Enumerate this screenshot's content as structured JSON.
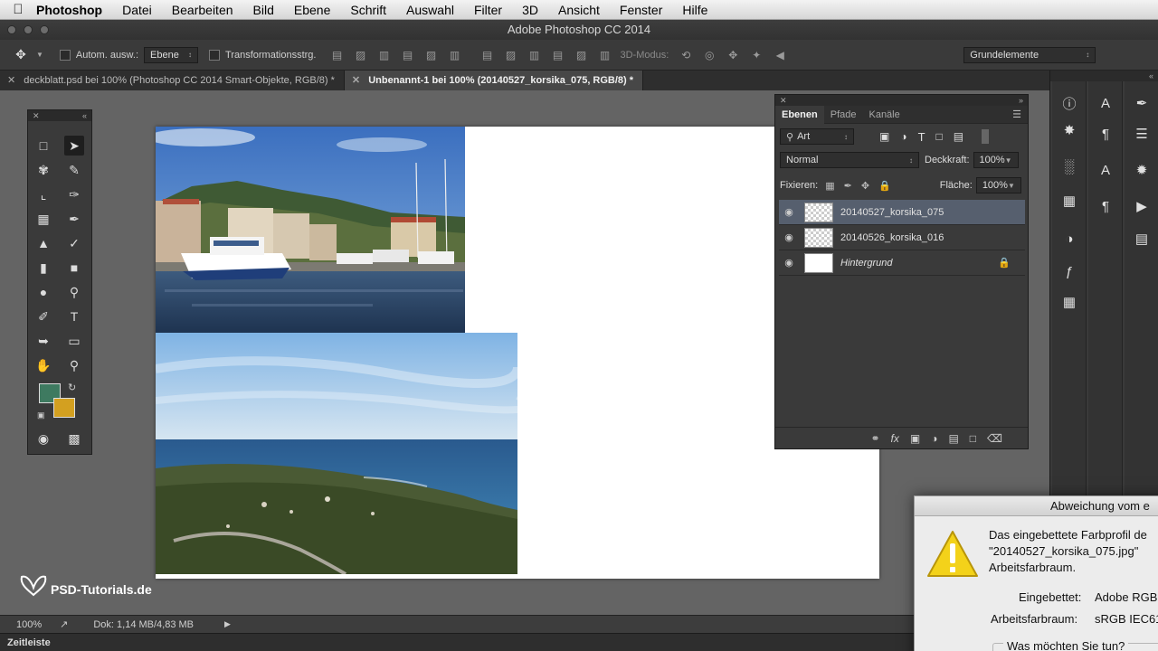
{
  "menubar": {
    "app": "Photoshop",
    "items": [
      "Datei",
      "Bearbeiten",
      "Bild",
      "Ebene",
      "Schrift",
      "Auswahl",
      "Filter",
      "3D",
      "Ansicht",
      "Fenster",
      "Hilfe"
    ]
  },
  "window": {
    "title": "Adobe Photoshop CC 2014"
  },
  "options": {
    "auto_select_label": "Autom. ausw.:",
    "auto_select_value": "Ebene",
    "transform_label": "Transformationsstrg.",
    "mode3d_label": "3D-Modus:",
    "workspace_value": "Grundelemente"
  },
  "tabs": [
    {
      "label": "deckblatt.psd bei 100% (Photoshop CC 2014  Smart-Objekte, RGB/8) *"
    },
    {
      "label": "Unbenannt-1 bei 100% (20140527_korsika_075, RGB/8) *"
    }
  ],
  "colors": {
    "foreground": "#3e7a60",
    "background": "#d3a020"
  },
  "layers_panel": {
    "tabs": [
      "Ebenen",
      "Pfade",
      "Kanäle"
    ],
    "filter_value": "Art",
    "blend_mode": "Normal",
    "opacity_label": "Deckkraft:",
    "opacity_value": "100%",
    "lock_label": "Fixieren:",
    "fill_label": "Fläche:",
    "fill_value": "100%",
    "layers": [
      {
        "name": "20140527_korsika_075"
      },
      {
        "name": "20140526_korsika_016"
      },
      {
        "name": "Hintergrund"
      }
    ]
  },
  "status": {
    "zoom": "100%",
    "doc": "Dok: 1,14 MB/4,83 MB"
  },
  "timeline": {
    "label": "Zeitleiste"
  },
  "watermark": {
    "text": "PSD-Tutorials.de"
  },
  "dialog": {
    "title": "Abweichung vom e",
    "message_line1": "Das eingebettete Farbprofil de",
    "message_line2": "\"20140527_korsika_075.jpg\"",
    "message_line3": "Arbeitsfarbraum.",
    "embedded_label": "Eingebettet:",
    "embedded_value": "Adobe RGB",
    "workspace_label": "Arbeitsfarbraum:",
    "workspace_value": "sRGB IEC61",
    "question": "Was möchten Sie tun?"
  }
}
